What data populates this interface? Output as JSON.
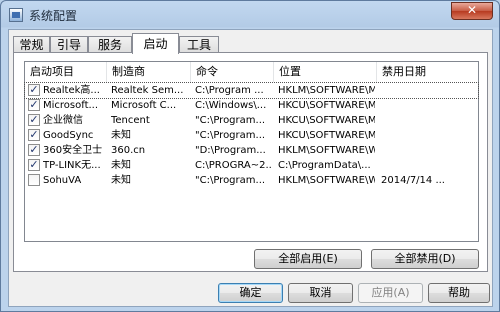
{
  "window": {
    "title": "系统配置",
    "close_symbol": "✕"
  },
  "tabs": [
    {
      "label": "常规",
      "active": false
    },
    {
      "label": "引导",
      "active": false
    },
    {
      "label": "服务",
      "active": false
    },
    {
      "label": "启动",
      "active": true
    },
    {
      "label": "工具",
      "active": false
    }
  ],
  "table": {
    "headers": [
      "启动项目",
      "制造商",
      "命令",
      "位置",
      "禁用日期"
    ],
    "rows": [
      {
        "checked": true,
        "item": "Realtek高...",
        "maker": "Realtek Sem...",
        "command": "C:\\Program ...",
        "location": "HKLM\\SOFTWARE\\M...",
        "date": ""
      },
      {
        "checked": true,
        "item": "Microsoft...",
        "maker": "Microsoft C...",
        "command": "C:\\Windows\\...",
        "location": "HKCU\\SOFTWARE\\M...",
        "date": ""
      },
      {
        "checked": true,
        "item": "企业微信",
        "maker": "Tencent",
        "command": "\"C:\\Program...",
        "location": "HKCU\\SOFTWARE\\M...",
        "date": ""
      },
      {
        "checked": true,
        "item": "GoodSync",
        "maker": "未知",
        "command": "\"C:\\Program...",
        "location": "HKCU\\SOFTWARE\\M...",
        "date": ""
      },
      {
        "checked": true,
        "item": "360安全卫士",
        "maker": "360.cn",
        "command": "\"D:\\Program...",
        "location": "HKLM\\SOFTWARE\\W...",
        "date": ""
      },
      {
        "checked": true,
        "item": "TP-LINK无...",
        "maker": "未知",
        "command": "C:\\PROGRA~2...",
        "location": "C:\\ProgramData\\...",
        "date": ""
      },
      {
        "checked": false,
        "item": "SohuVA",
        "maker": "未知",
        "command": "\"C:\\Program...",
        "location": "HKLM\\SOFTWARE\\W...",
        "date": "2014/7/14 ..."
      }
    ]
  },
  "buttons": {
    "enable_all": "全部启用(E)",
    "disable_all": "全部禁用(D)",
    "ok": "确定",
    "cancel": "取消",
    "apply": "应用(A)",
    "help": "帮助"
  },
  "check_symbol": "✓"
}
